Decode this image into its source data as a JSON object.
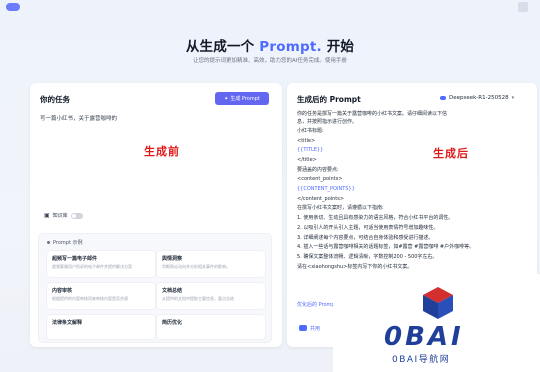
{
  "hero": {
    "title_prefix": "从生成一个",
    "title_accent": "Prompt.",
    "title_suffix": "开始",
    "subtitle": "让您的提示词更加精准、高效，助力您的AI任务完成。使用手册"
  },
  "left_panel": {
    "title": "你的任务",
    "generate_button": "生成 Prompt",
    "task_text": "写一篇小红书，关于露营咖啡的",
    "overlay_label": "生成前",
    "knowledge_base_label": "知识库",
    "knowledge_base_enabled": false,
    "examples_title": "Prompt 示例",
    "examples": [
      {
        "title": "超频写一篇电子邮件",
        "desc": "超频客服用户投诉的电子邮件并提供解决方案"
      },
      {
        "title": "舆情洞察",
        "desc": "判断舆论动向并分析相关事件的影响。"
      },
      {
        "title": "内容审核",
        "desc": "根据提供的内容审核项来审核内容是否合规"
      },
      {
        "title": "文档总结",
        "desc": "从提供的文档中提取主要信息，要点总结"
      },
      {
        "title": "法律条文解释",
        "desc": ""
      },
      {
        "title": "简历优化",
        "desc": ""
      }
    ]
  },
  "right_panel": {
    "title": "生成后的 Prompt",
    "model": "Deepseek-R1-250528",
    "overlay_label": "生成后",
    "result_lines": [
      {
        "text": "你的任务是撰写一篇关于露营咖啡的小红书文案。请仔细阅读以下信息，并按照指示进行创作。",
        "highlight": false
      },
      {
        "text": "小红书标题:",
        "highlight": false
      },
      {
        "text": "<title>",
        "highlight": false
      },
      {
        "text": "{{TITLE}}",
        "highlight": true
      },
      {
        "text": "</title>",
        "highlight": false
      },
      {
        "text": "要涵盖的内容要点:",
        "highlight": false
      },
      {
        "text": "<content_points>",
        "highlight": false
      },
      {
        "text": "{{CONTENT_POINTS}}",
        "highlight": true
      },
      {
        "text": "</content_points>",
        "highlight": false
      },
      {
        "text": "在撰写小红书文案时，请遵循以下指南:",
        "highlight": false
      },
      {
        "text": "1. 使用亲切、生动且具有感染力的语言风格，符合小红书平台的调性。",
        "highlight": false
      },
      {
        "text": "2. 以吸引人的开头引入主题，可适当使用表情符号增加趣味性。",
        "highlight": false
      },
      {
        "text": "3. 详细阐述每个内容要点，可结合自身体验和感受进行描述。",
        "highlight": false
      },
      {
        "text": "4. 插入一些话与露营咖啡相关的话题标签，如#露营 #露营咖啡 #户外咖啡等。",
        "highlight": false
      },
      {
        "text": "5. 确保文案整体流畅、逻辑清晰，字数控制200 - 500字左右。",
        "highlight": false
      },
      {
        "text": "请在<xiaohongshu>标签内写下你的小红书文案。",
        "highlight": false
      }
    ],
    "optimize_link": "优化后的 Prompt",
    "bottom_text": "共用"
  },
  "watermark": {
    "brand": "0BAI",
    "sub": "0BAI导航网"
  },
  "colors": {
    "accent": "#4f6bff",
    "button": "#6366f1",
    "overlay_red": "#e01818",
    "watermark_blue": "#1f3f9a",
    "watermark_red": "#d32f2f"
  }
}
